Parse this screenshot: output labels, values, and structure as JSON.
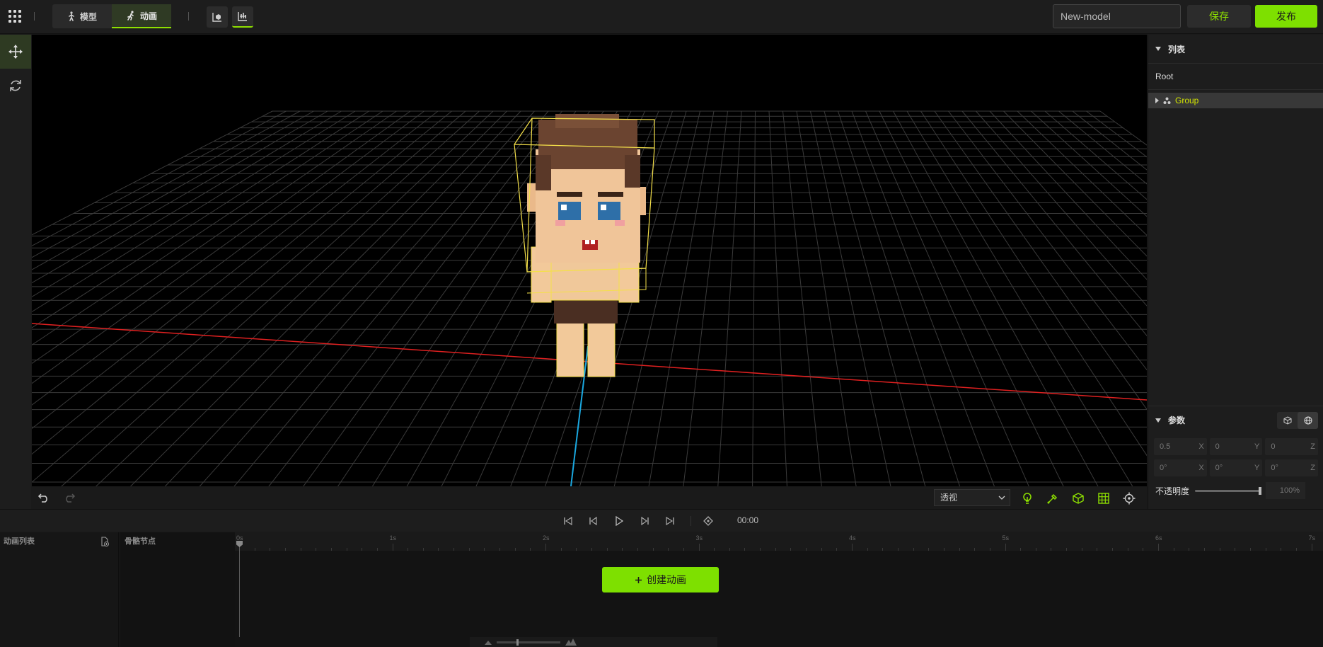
{
  "header": {
    "mode_tabs": [
      {
        "label": "模型",
        "active": false
      },
      {
        "label": "动画",
        "active": true
      }
    ],
    "model_name": "New-model",
    "save_label": "保存",
    "publish_label": "发布"
  },
  "colors": {
    "accent": "#7ee000",
    "selection": "#d4e600",
    "axis_x": "#e02020",
    "axis_z": "#1aa8e0",
    "bbox": "#f4e04a"
  },
  "left_tools": [
    {
      "icon": "move-arrows-icon",
      "active": true
    },
    {
      "icon": "rotate-icon",
      "active": false
    }
  ],
  "viewport_toolbar": {
    "view_mode": "透视",
    "icons": [
      "undo-icon",
      "redo-icon",
      "light-bulb-icon",
      "pen-icon",
      "cube-icon",
      "grid-icon",
      "target-icon"
    ]
  },
  "outline": {
    "title": "列表",
    "root_label": "Root",
    "group_label": "Group"
  },
  "params": {
    "title": "参数",
    "rows": [
      [
        {
          "value": "0.5",
          "axis": "X"
        },
        {
          "value": "0",
          "axis": "Y"
        },
        {
          "value": "0",
          "axis": "Z"
        }
      ],
      [
        {
          "value": "0°",
          "axis": "X"
        },
        {
          "value": "0°",
          "axis": "Y"
        },
        {
          "value": "0°",
          "axis": "Z"
        }
      ]
    ],
    "opacity_label": "不透明度",
    "opacity_value": "100%",
    "opacity_fraction": 1.0
  },
  "timeline": {
    "timecode": "00:00",
    "anim_list_label": "动画列表",
    "bones_label": "骨骼节点",
    "ticks": [
      "0s",
      "1s",
      "2s",
      "3s",
      "4s",
      "5s",
      "6s",
      "7s"
    ],
    "create_label": "创建动画"
  }
}
